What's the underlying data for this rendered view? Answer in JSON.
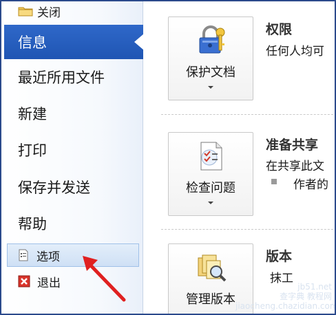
{
  "sidebar": {
    "close_label": "关闭",
    "info_label": "信息",
    "recent_label": "最近所用文件",
    "new_label": "新建",
    "print_label": "打印",
    "save_send_label": "保存并发送",
    "help_label": "帮助",
    "options_label": "选项",
    "exit_label": "退出"
  },
  "main": {
    "permissions": {
      "button_label": "保护文档",
      "title": "权限",
      "description": "任何人均可"
    },
    "prepare": {
      "button_label": "检查问题",
      "title": "准备共享",
      "description": "在共享此文",
      "bullet": "作者的"
    },
    "versions": {
      "button_label": "管理版本",
      "title": "版本",
      "description": "抹工"
    }
  },
  "watermark": {
    "line1": "jb51.net",
    "line2": "查字典 教程网",
    "line3": "jiaocheng.chazidian.com"
  },
  "colors": {
    "accent": "#2b62c2",
    "arrow": "#e02020"
  }
}
